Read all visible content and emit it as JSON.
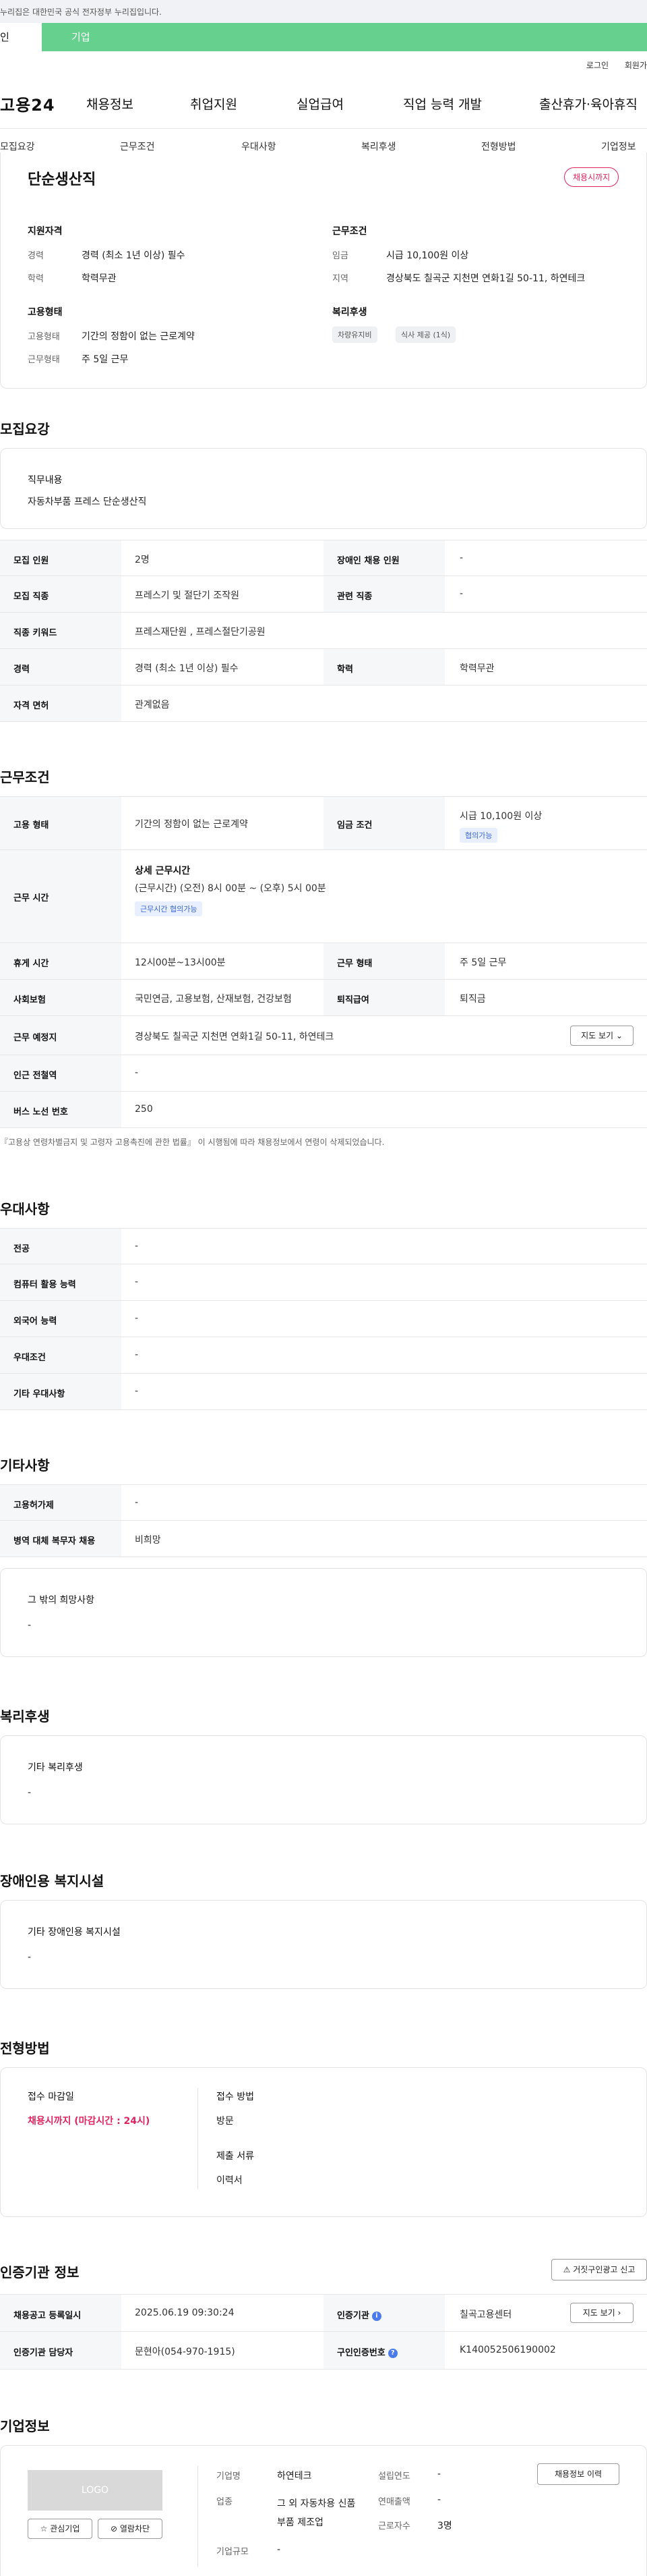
{
  "gov_banner": "누리집은 대한민국 공식 전자정부 누리집입니다.",
  "user_tabs": [
    "인",
    "기업"
  ],
  "top_links": [
    "로그인",
    "회원가"
  ],
  "site_logo": "고용24",
  "gnb": [
    "채용정보",
    "취업지원",
    "실업급여",
    "직업 능력 개발",
    "출산휴가·육아휴직"
  ],
  "subnav": [
    "모집요강",
    "근무조건",
    "우대사항",
    "복리후생",
    "전형방법",
    "기업정보"
  ],
  "summary": {
    "job_title": "단순생산직",
    "status_badge": "채용시까지",
    "qual_heading": "지원자격",
    "career_label": "경력",
    "career_value": "경력 (최소 1년 이상) 필수",
    "edu_label": "학력",
    "edu_value": "학력무관",
    "emp_heading": "고용형태",
    "emp_type_label": "고용형태",
    "emp_type_value": "기간의 정함이 없는 근로계약",
    "work_days_label": "근무형태",
    "work_days_value": "주 5일 근무",
    "cond_heading": "근무조건",
    "wage_label": "임금",
    "wage_value": "시급 10,100원 이상",
    "region_label": "지역",
    "region_value": "경상북도 칠곡군 지천면 연화1길 50-11, 하연테크",
    "welfare_heading": "복리후생",
    "welfare_chips": [
      "차량유지비",
      "식사 제공 (1식)"
    ]
  },
  "recruit": {
    "section_title": "모집요강",
    "duty_label": "직무내용",
    "duty_value": "자동차부품 프레스 단순생산직",
    "rows": [
      {
        "h1": "모집 인원",
        "v1": "2명",
        "h2": "장애인 채용 인원",
        "v2": "-"
      },
      {
        "h1": "모집 직종",
        "v1": "프레스기 및 절단기 조작원",
        "h2": "관련 직종",
        "v2": "-"
      },
      {
        "h1": "직종 키워드",
        "v1": "프레스재단원 , 프레스절단기공원"
      },
      {
        "h1": "경력",
        "v1": "경력 (최소 1년 이상) 필수",
        "h2": "학력",
        "v2": "학력무관"
      },
      {
        "h1": "자격 면허",
        "v1": "관계없음"
      }
    ]
  },
  "conditions": {
    "section_title": "근무조건",
    "emp_type_h": "고용 형태",
    "emp_type_v": "기간의 정함이 없는 근로계약",
    "wage_h": "임금 조건",
    "wage_v": "시급 10,100원 이상",
    "wage_chip": "협의가능",
    "hours_h": "근무 시간",
    "hours_sub": "상세 근무시간",
    "hours_v": "(근무시간) (오전) 8시 00분 ~ (오후) 5시 00분",
    "hours_chip": "근무시간 협의가능",
    "break_h": "휴게 시간",
    "break_v": "12시00분~13시00분",
    "shift_h": "근무 형태",
    "shift_v": "주 5일 근무",
    "insurance_h": "사회보험",
    "insurance_v": "국민연금, 고용보험, 산재보험, 건강보험",
    "retire_h": "퇴직급여",
    "retire_v": "퇴직금",
    "place_h": "근무 예정지",
    "place_v": "경상북도 칠곡군 지천면 연화1길 50-11, 하연테크",
    "map_btn": "지도 보기",
    "subway_h": "인근 전철역",
    "subway_v": "-",
    "bus_h": "버스 노선 번호",
    "bus_v": "250",
    "footnote": "『고용상 연령차별금지 및 고령자 고용촉진에 관한 법률』 이 시행됨에 따라 채용정보에서 연령이 삭제되었습니다."
  },
  "preference": {
    "section_title": "우대사항",
    "rows": [
      {
        "h": "전공",
        "v": "-"
      },
      {
        "h": "컴퓨터 활용 능력",
        "v": "-"
      },
      {
        "h": "외국어 능력",
        "v": "-"
      },
      {
        "h": "우대조건",
        "v": "-"
      },
      {
        "h": "기타 우대사항",
        "v": "-"
      }
    ]
  },
  "etc": {
    "section_title": "기타사항",
    "rows": [
      {
        "h": "고용허가제",
        "v": "-"
      },
      {
        "h": "병역 대체 복무자 채용",
        "v": "비희망"
      }
    ],
    "other_label": "그 밖의 희망사항",
    "other_value": "-"
  },
  "welfare": {
    "section_title": "복리후생",
    "label": "기타 복리후생",
    "value": "-"
  },
  "disability": {
    "section_title": "장애인용 복지시설",
    "label": "기타 장애인용 복지시설",
    "value": "-"
  },
  "selection": {
    "section_title": "전형방법",
    "deadline_label": "접수 마감일",
    "deadline_value": "채용시까지 (마감시간 : 24시)",
    "method_label": "접수 방법",
    "method_value": "방문",
    "docs_label": "제출 서류",
    "docs_value": "이력서"
  },
  "agency": {
    "section_title": "인증기관 정보",
    "report_btn": "거짓구인광고 신고",
    "reg_h": "채용공고 등록일시",
    "reg_v": "2025.06.19 09:30:24",
    "agency_h": "인증기관",
    "agency_v": "칠곡고용센터",
    "map_btn": "지도 보기",
    "manager_h": "인증기관 담당자",
    "manager_v": "문현아(054-970-1915)",
    "cert_h": "구인인증번호",
    "cert_v": "K140052506190002"
  },
  "company": {
    "section_title": "기업정보",
    "logo_text": "LOGO",
    "interest_btn": "관심기업",
    "block_btn": "열람차단",
    "name_label": "기업명",
    "name_value": "하연테크",
    "industry_label": "업종",
    "industry_value": "그 외 자동차용 신품 부품 제조업",
    "size_label": "기업규모",
    "size_value": "-",
    "founded_label": "설립연도",
    "founded_value": "-",
    "revenue_label": "연매출액",
    "revenue_value": "-",
    "employees_label": "근로자수",
    "employees_value": "3명",
    "history_btn": "채용정보 이력"
  },
  "colors": {
    "accent_green": "#66d08e",
    "badge_red": "#e0245e",
    "info_blue": "#4b7bec"
  }
}
